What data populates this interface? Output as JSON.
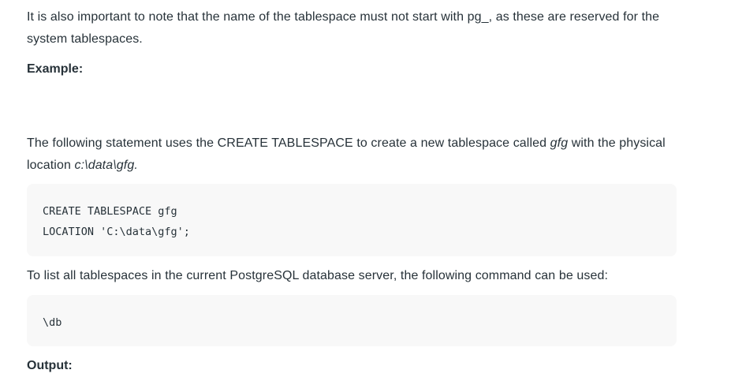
{
  "paragraphs": {
    "p1_text": "It is also important to note that the name of the tablespace must not start with pg_, as these are reserved for the system tablespaces.",
    "p2_part1": "The following statement uses the ",
    "p2_keyword": "CREATE TABLESPACE",
    "p2_part2": " to create a new tablespace called ",
    "p2_name": "gfg",
    "p2_part3": " with the physical location ",
    "p2_location": "c:\\data\\gfg.",
    "p3_text": "To list all tablespaces in the current PostgreSQL database server, the following command can be used:"
  },
  "headings": {
    "example": "Example:",
    "output": "Output:"
  },
  "code": {
    "block1_line1": "CREATE TABLESPACE gfg",
    "block1_line2": "LOCATION 'C:\\data\\gfg';",
    "block2_line1": "\\db"
  }
}
